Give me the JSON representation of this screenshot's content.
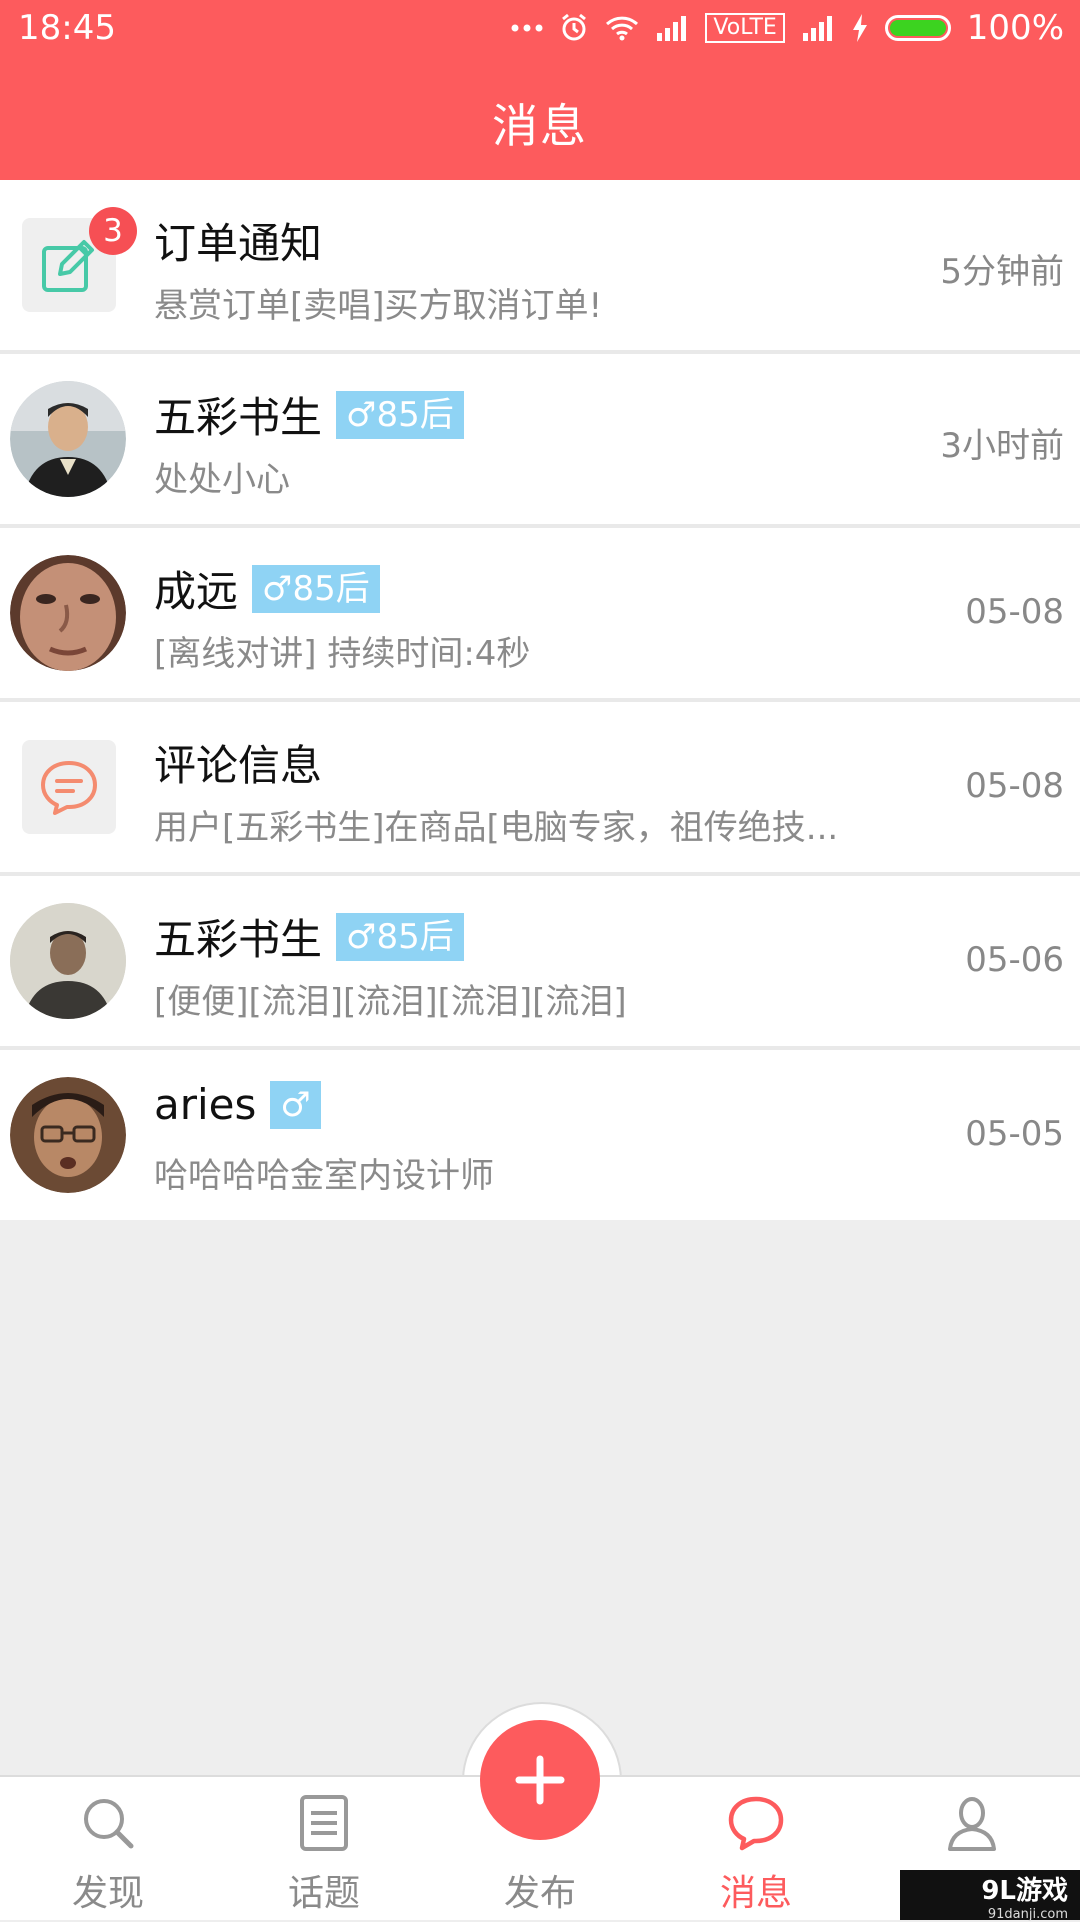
{
  "status_bar": {
    "time": "18:45",
    "network": "VoLTE",
    "battery": "100%",
    "battery_level": 1.0,
    "icons": [
      "more-dots-icon",
      "alarm-icon",
      "wifi-icon",
      "signal-icon",
      "signal-icon",
      "charging-icon",
      "battery-icon"
    ]
  },
  "header": {
    "title": "消息"
  },
  "messages": [
    {
      "kind": "system",
      "icon": "edit-icon",
      "icon_color": "#47c9a7",
      "title": "订单通知",
      "tag": "",
      "preview": "悬赏订单[卖唱]买方取消订单!",
      "time": "5分钟前",
      "badge": "3"
    },
    {
      "kind": "user",
      "avatar": "avatar-photo",
      "title": "五彩书生",
      "tag": "♂85后",
      "preview": "处处小心",
      "time": "3小时前"
    },
    {
      "kind": "user",
      "avatar": "avatar-photo",
      "title": "成远",
      "tag": "♂85后",
      "preview": "[离线对讲] 持续时间:4秒",
      "time": "05-08"
    },
    {
      "kind": "system",
      "icon": "comment-icon",
      "icon_color": "#f48b6f",
      "title": "评论信息",
      "tag": "",
      "preview": "用户[五彩书生]在商品[电脑专家，祖传绝技...",
      "time": "05-08"
    },
    {
      "kind": "user",
      "avatar": "avatar-photo",
      "title": "五彩书生",
      "tag": "♂85后",
      "preview": "[便便][流泪][流泪][流泪][流泪]",
      "time": "05-06"
    },
    {
      "kind": "user",
      "avatar": "avatar-photo",
      "title": "aries",
      "tag": "♂",
      "preview": "哈哈哈哈金室内设计师",
      "time": "05-05"
    }
  ],
  "bottom_nav": {
    "items": [
      {
        "label": "发现",
        "icon": "search-icon"
      },
      {
        "label": "话题",
        "icon": "list-icon"
      },
      {
        "label": "发布",
        "icon": "plus-icon"
      },
      {
        "label": "消息",
        "icon": "chat-bubble-icon",
        "active": true
      },
      {
        "label": "",
        "icon": "person-icon"
      }
    ]
  },
  "watermark": {
    "brand": "9L游戏",
    "url": "91danji.com"
  },
  "colors": {
    "accent": "#fd5b5d",
    "tag": "#8fd3f4",
    "badge": "#f64f54"
  }
}
